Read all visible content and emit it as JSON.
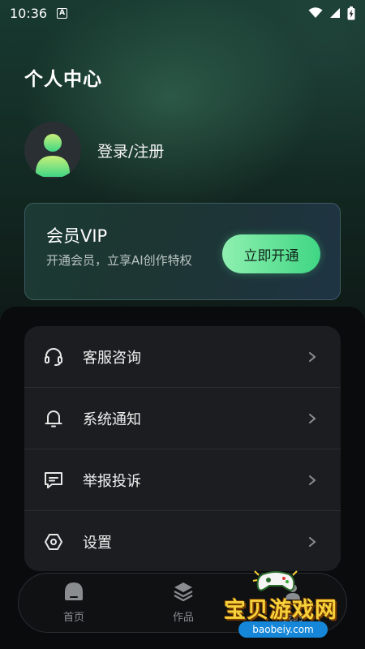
{
  "status_bar": {
    "time": "10:36",
    "notification_icon_letter": "A"
  },
  "page": {
    "title": "个人中心"
  },
  "profile": {
    "login_label": "登录/注册"
  },
  "vip": {
    "title": "会员VIP",
    "subtitle": "开通会员，立享AI创作特权",
    "button_label": "立即开通",
    "accent_color": "#3fd684"
  },
  "menu": {
    "items": [
      {
        "label": "客服咨询",
        "icon": "headset-icon"
      },
      {
        "label": "系统通知",
        "icon": "bell-icon"
      },
      {
        "label": "举报投诉",
        "icon": "message-icon"
      },
      {
        "label": "设置",
        "icon": "hexagon-settings-icon"
      }
    ]
  },
  "tabs": {
    "items": [
      {
        "label": "首页",
        "icon": "home-icon"
      },
      {
        "label": "作品",
        "icon": "layers-icon"
      },
      {
        "label": "我的",
        "icon": "profile-icon"
      }
    ]
  },
  "watermark": {
    "text": "宝贝游戏网",
    "url": "baobeiy.com"
  }
}
